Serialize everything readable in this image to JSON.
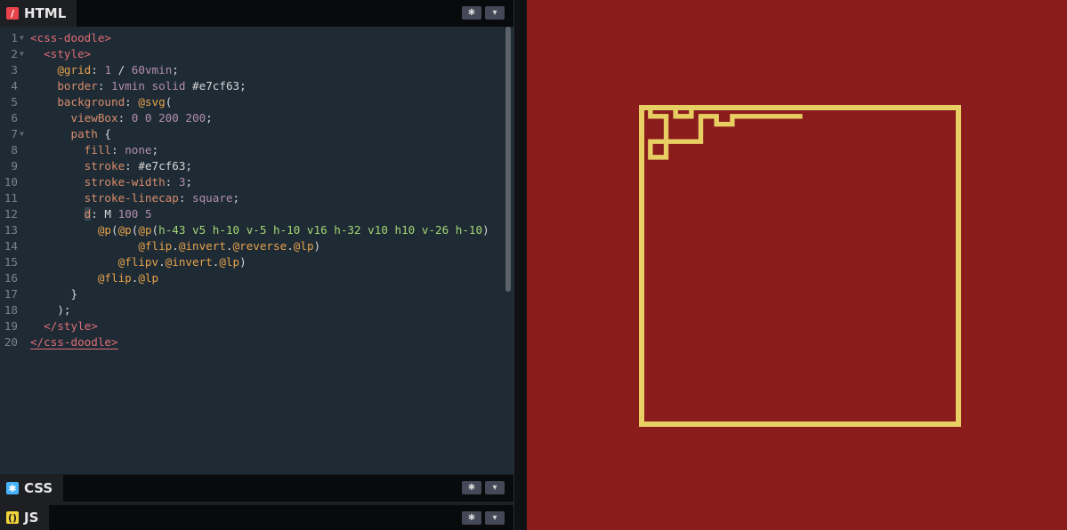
{
  "editor": {
    "html_tab": {
      "label": "HTML",
      "icon": "html-slash-icon",
      "accent": "#e8424a"
    },
    "css_tab": {
      "label": "CSS",
      "icon": "css-asterisk-icon",
      "accent": "#47b3ff"
    },
    "js_tab": {
      "label": "JS",
      "icon": "js-braces-icon",
      "accent": "#f2d23b"
    },
    "settings_icon": "gear-icon",
    "collapse_icon": "chevron-down-icon",
    "line_numbers": [
      "1",
      "2",
      "3",
      "4",
      "5",
      "6",
      "7",
      "8",
      "9",
      "10",
      "11",
      "12",
      "13",
      "14",
      "15",
      "16",
      "17",
      "18",
      "19",
      "20"
    ],
    "lines": [
      "<css-doodle>",
      "  <style>",
      "    @grid: 1 / 60vmin;",
      "    border: 1vmin solid #e7cf63;",
      "    background: @svg(",
      "      viewBox: 0 0 200 200;",
      "      path {",
      "        fill: none;",
      "        stroke: #e7cf63;",
      "        stroke-width: 3;",
      "        stroke-linecap: square;",
      "        d: M 100 5",
      "          @p(@p(@p(h-43 v5 h-10 v-5 h-10 v16 h-32 v10 h10 v-26 h-10)",
      "                @flip.@invert.@reverse.@lp)",
      "             @flipv.@invert.@lp)",
      "          @flip.@lp",
      "      }",
      "    );",
      "  </style>",
      "</css-doodle>"
    ]
  },
  "preview": {
    "background": "#8b1c1c",
    "frame_color": "#e7cf63"
  }
}
